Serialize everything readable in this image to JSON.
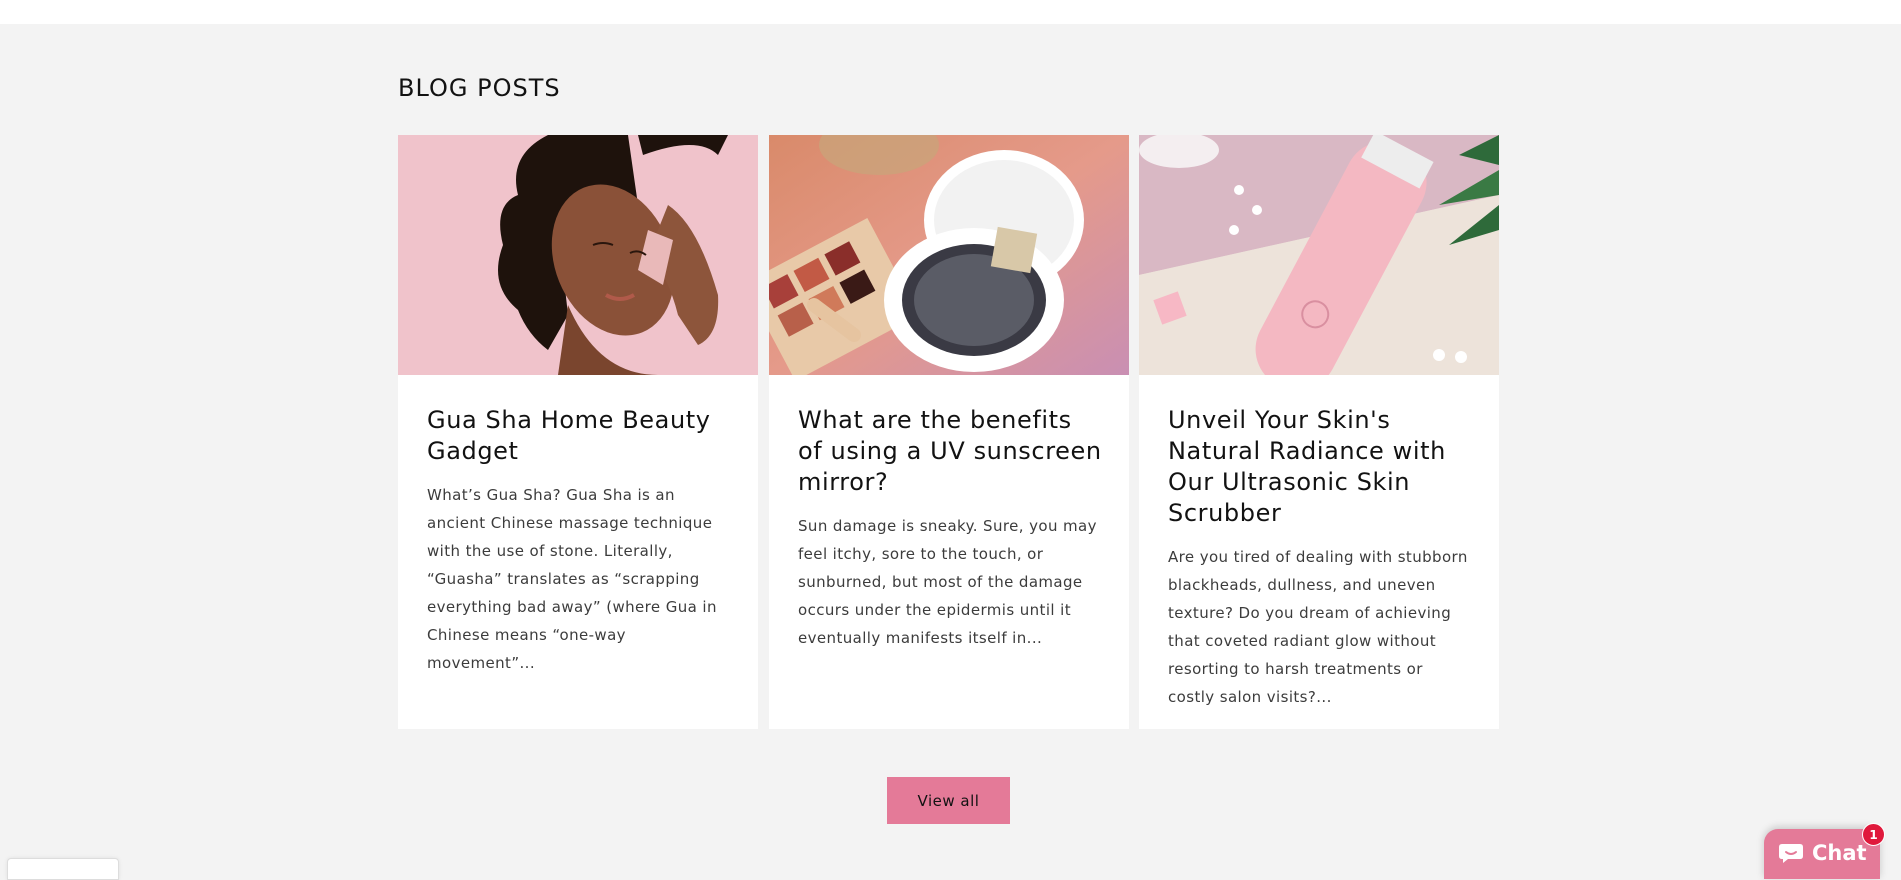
{
  "section": {
    "title": "BLOG POSTS"
  },
  "posts": [
    {
      "title": "Gua Sha Home Beauty Gadget",
      "excerpt": "What’s Gua Sha? Gua Sha is an ancient Chinese massage technique with the use of stone. Literally, “Guasha” translates as “scrapping everything bad away” (where Gua in Chinese means “one-way movement”...",
      "image": "woman-with-gua-sha-stone-image"
    },
    {
      "title": "What are the benefits of using a UV sunscreen mirror?",
      "excerpt": "Sun damage is sneaky. Sure, you may feel itchy, sore to the touch, or sunburned, but most of the damage occurs under the epidermis until it eventually manifests itself in...",
      "image": "compact-mirror-and-eyeshadow-image"
    },
    {
      "title": "Unveil Your Skin's Natural Radiance with Our Ultrasonic Skin Scrubber",
      "excerpt": "Are you tired of dealing with stubborn blackheads, dullness, and uneven texture? Do you dream of achieving that coveted radiant glow without resorting to harsh treatments or costly salon visits?...",
      "image": "pink-ultrasonic-scrubber-image"
    }
  ],
  "view_all": {
    "label": "View all"
  },
  "chat": {
    "label": "Chat",
    "badge": "1",
    "icon": "chat-bubble-icon"
  },
  "colors": {
    "accent": "#e47a98",
    "background": "#f3f3f3",
    "card": "#ffffff",
    "badge": "#e0193c"
  }
}
